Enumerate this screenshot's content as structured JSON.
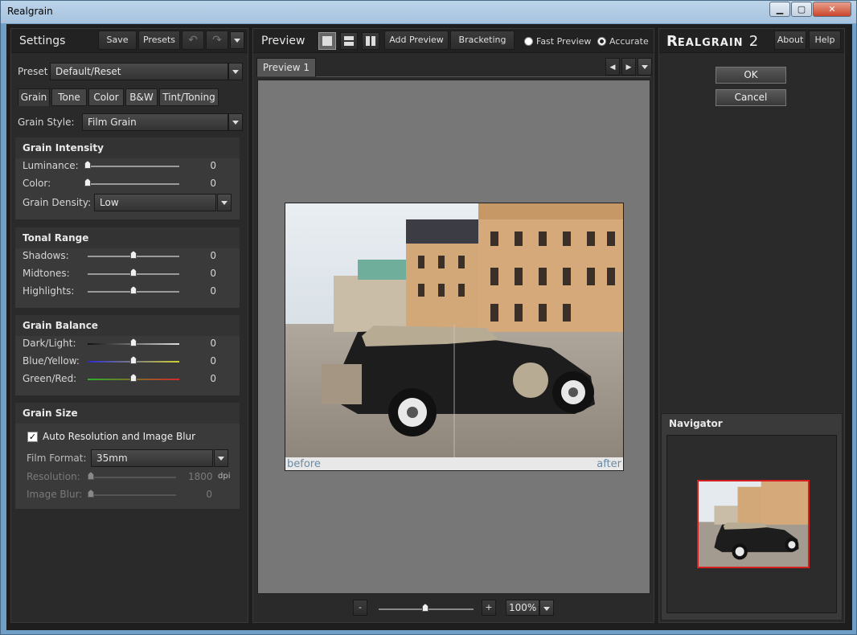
{
  "window": {
    "title": "Realgrain",
    "minimize": "▁",
    "maximize": "▢",
    "close": "✕"
  },
  "settings": {
    "title": "Settings",
    "save": "Save",
    "presets": "Presets",
    "undo": "↶",
    "redo": "↷",
    "preset_label": "Preset",
    "preset_value": "Default/Reset",
    "tabs": [
      "Grain",
      "Tone",
      "Color",
      "B&W",
      "Tint/Toning"
    ],
    "grain_style_label": "Grain Style:",
    "grain_style_value": "Film Grain",
    "grain_intensity": {
      "title": "Grain Intensity",
      "luminance_label": "Luminance:",
      "luminance_value": "0",
      "luminance_level": 0,
      "color_label": "Color:",
      "color_value": "0",
      "color_level": 0,
      "density_label": "Grain Density:",
      "density_value": "Low"
    },
    "tonal_range": {
      "title": "Tonal Range",
      "shadows_label": "Shadows:",
      "shadows_value": "0",
      "midtones_label": "Midtones:",
      "midtones_value": "0",
      "highlights_label": "Highlights:",
      "highlights_value": "0"
    },
    "grain_balance": {
      "title": "Grain Balance",
      "dark_light_label": "Dark/Light:",
      "dark_light_value": "0",
      "blue_yellow_label": "Blue/Yellow:",
      "blue_yellow_value": "0",
      "green_red_label": "Green/Red:",
      "green_red_value": "0"
    },
    "grain_size": {
      "title": "Grain Size",
      "auto_label": "Auto Resolution and Image Blur",
      "film_format_label": "Film Format:",
      "film_format_value": "35mm",
      "resolution_label": "Resolution:",
      "resolution_value": "1800",
      "resolution_unit": "dpi",
      "blur_label": "Image Blur:",
      "blur_value": "0"
    }
  },
  "preview": {
    "title": "Preview",
    "add_preview": "Add Preview",
    "bracketing": "Bracketing",
    "fast_preview": "Fast Preview",
    "accurate": "Accurate",
    "tab": "Preview 1",
    "before": "before",
    "after": "after",
    "zoom_minus": "-",
    "zoom_plus": "+",
    "zoom_value": "100%"
  },
  "right": {
    "brand_big": "R",
    "brand_rest": "EALGRAIN",
    "brand_num": "2",
    "about": "About",
    "help": "Help",
    "ok": "OK",
    "cancel": "Cancel",
    "navigator": "Navigator"
  },
  "colors": {
    "accent_red": "#d42020",
    "panel": "#2a2a2a"
  }
}
